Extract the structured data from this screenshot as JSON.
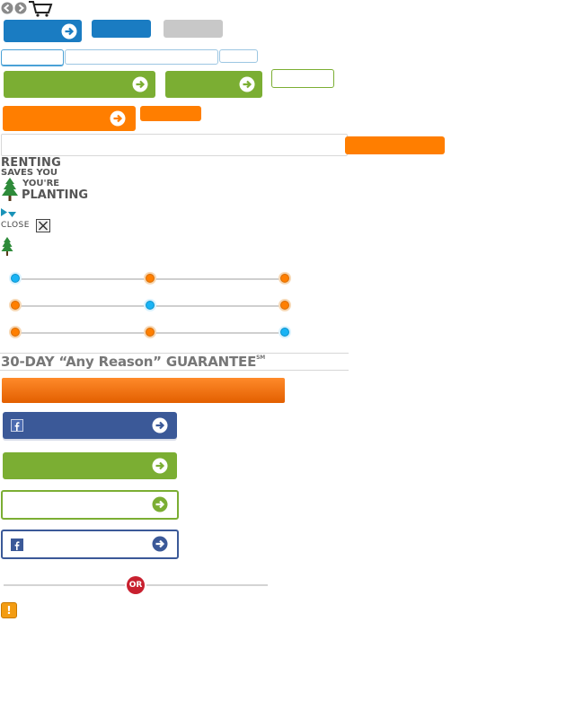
{
  "renting_sprite": {
    "line1": "RENTING",
    "line2": "SAVES YOU",
    "line3": "YOU'RE",
    "line4": "PLANTING"
  },
  "close_control": {
    "label": "CLOSE"
  },
  "guarantee": {
    "text": "30-DAY “Any Reason” GUARANTEE",
    "mark": "SM"
  },
  "or_badge": {
    "label": "OR"
  },
  "alert_icon": {
    "glyph": "!"
  },
  "colors": {
    "blue": "#1a7cc2",
    "green": "#7bae33",
    "orange": "#ff7e00",
    "gray": "#c8c8c8",
    "facebook": "#3b5998",
    "red_badge": "#c8202f",
    "slider_orange": "#ff7f00",
    "slider_blue": "#19b3f5"
  },
  "sliders": [
    {
      "active_index": 0
    },
    {
      "active_index": 1
    },
    {
      "active_index": 2
    }
  ]
}
